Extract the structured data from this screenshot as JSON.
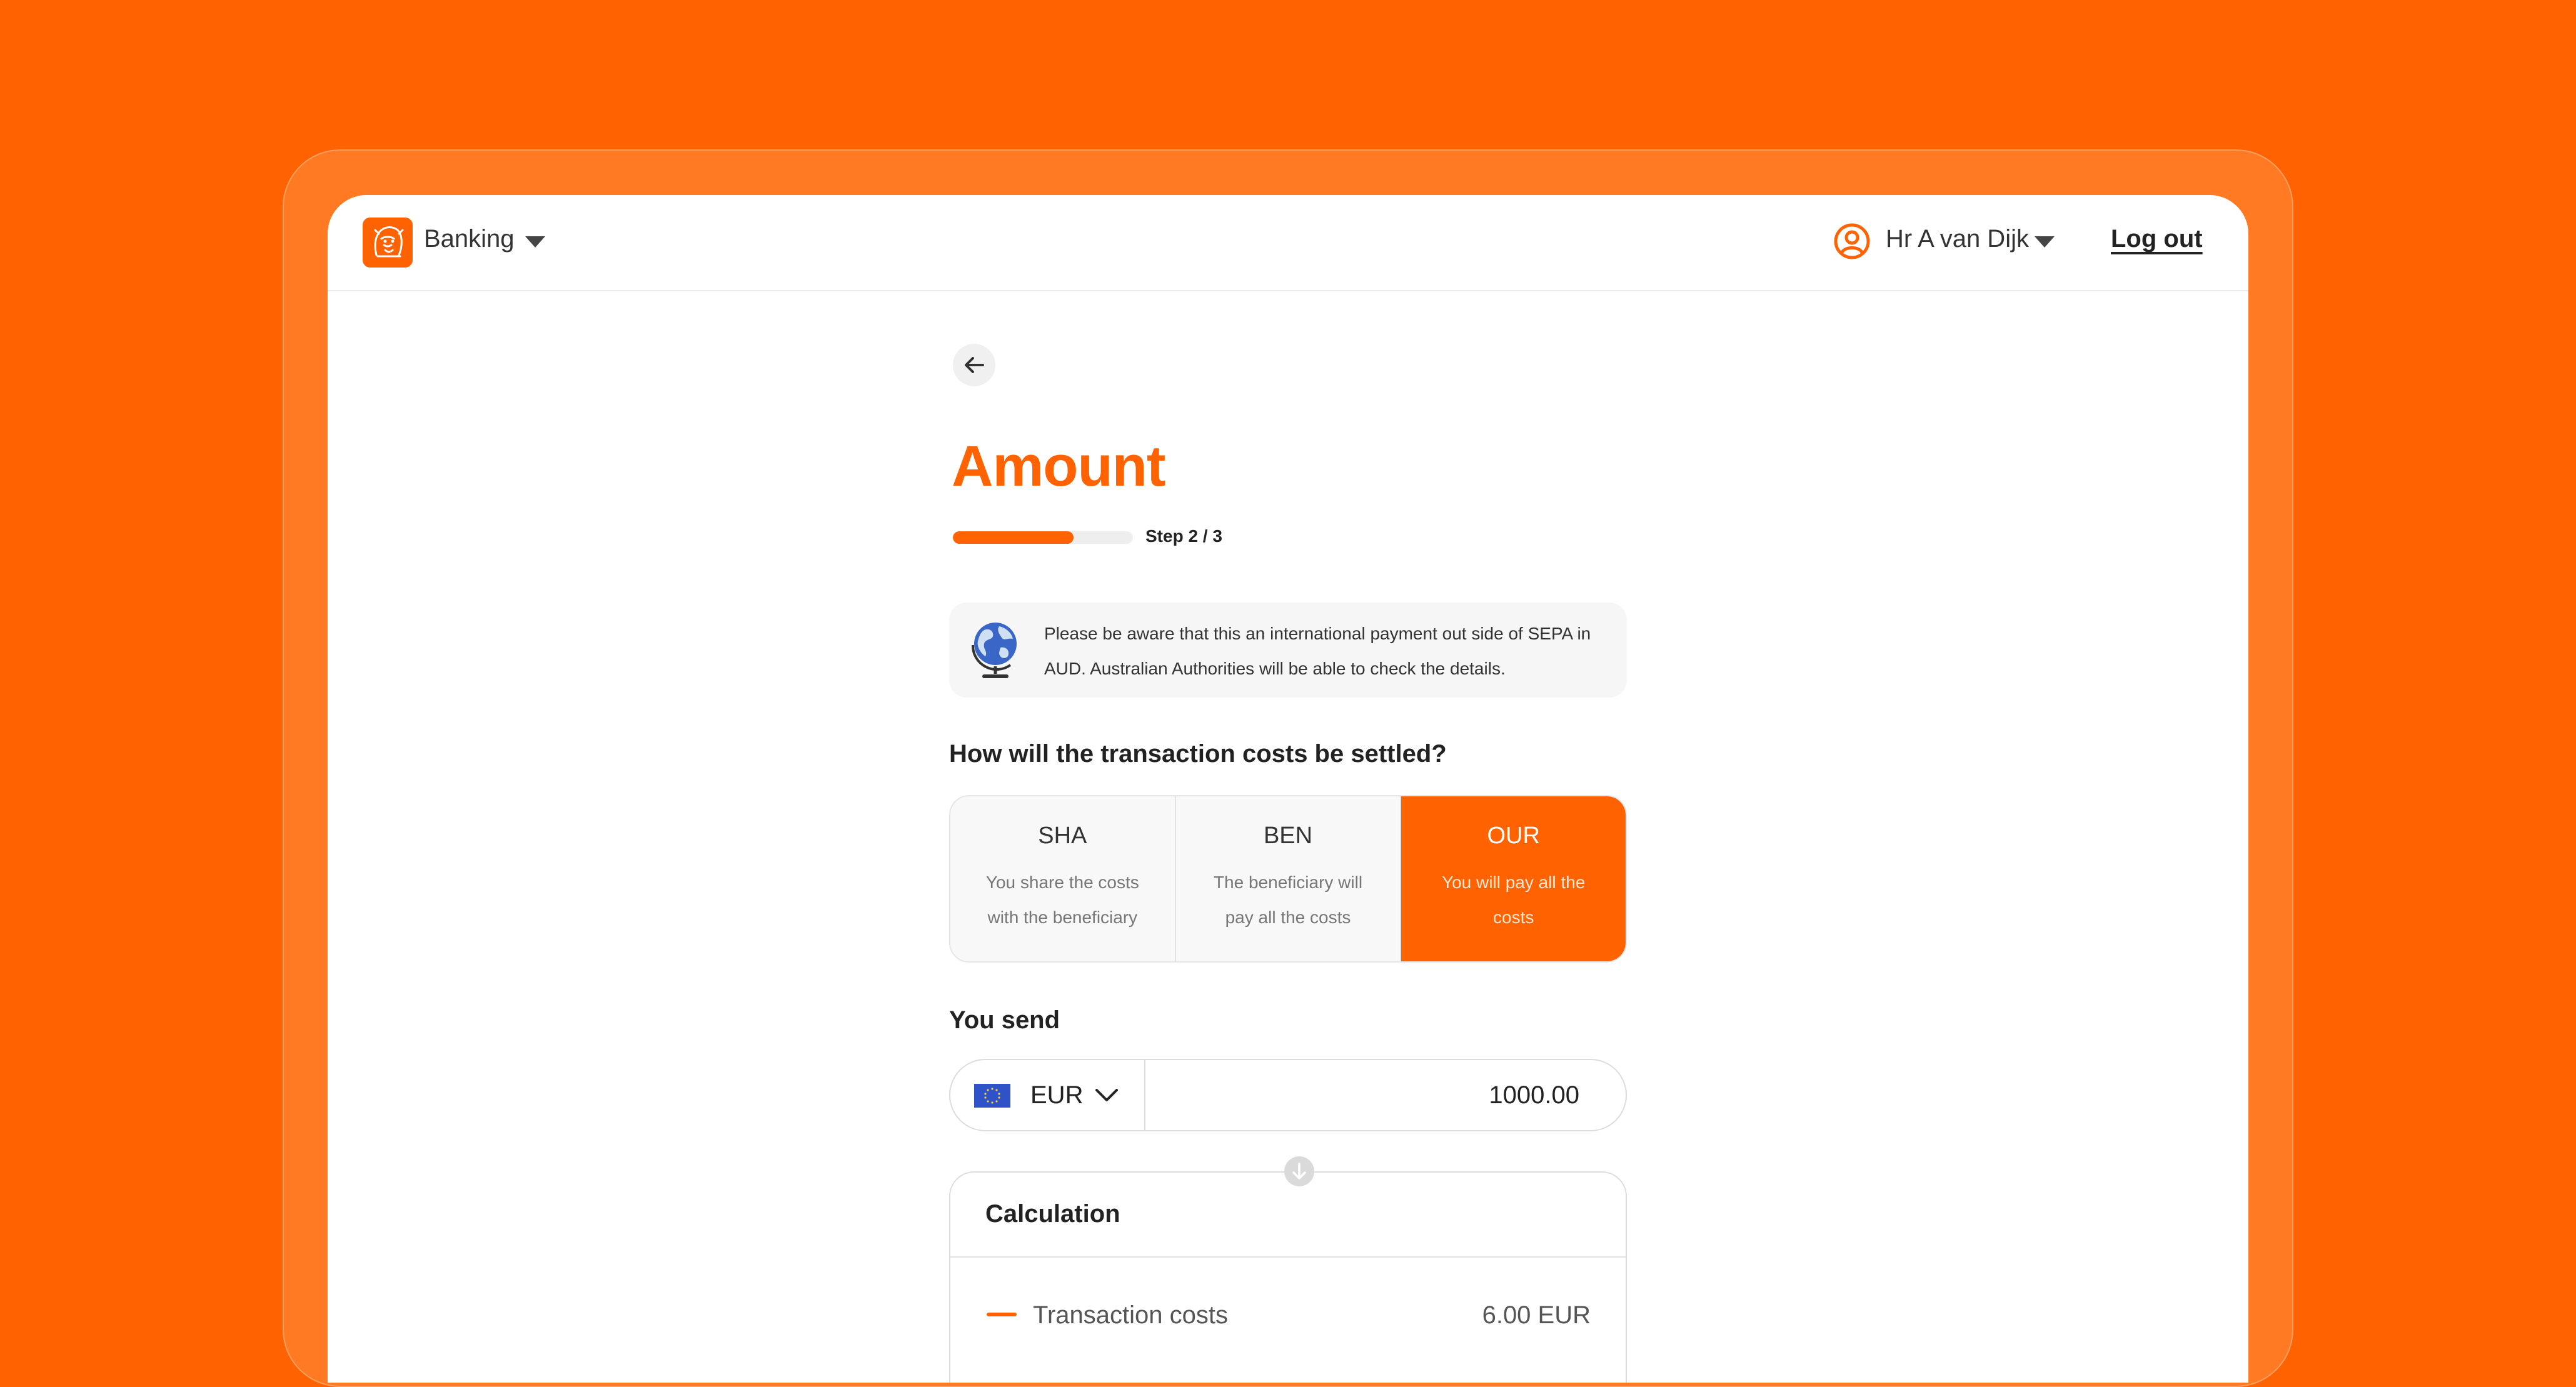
{
  "header": {
    "app_menu_label": "Banking",
    "user_name": "Hr A van Dijk",
    "logout_label": "Log out"
  },
  "page": {
    "title": "Amount",
    "step_label": "Step 2 / 3",
    "progress": 0.67
  },
  "notice": {
    "text": "Please be aware that this an international payment out side of SEPA in AUD. Australian Authorities will be able to check the details."
  },
  "costs": {
    "question": "How will the transaction costs be settled?",
    "options": [
      {
        "code": "SHA",
        "description": "You share the costs with the beneficiary",
        "selected": false
      },
      {
        "code": "BEN",
        "description": "The beneficiary will pay all the costs",
        "selected": false
      },
      {
        "code": "OUR",
        "description": "You will pay all the costs",
        "selected": true
      }
    ]
  },
  "send": {
    "label": "You send",
    "currency": "EUR",
    "amount": "1000.00"
  },
  "calculation": {
    "title": "Calculation",
    "rows": [
      {
        "label": "Transaction costs",
        "value": "6.00 EUR"
      }
    ]
  },
  "colors": {
    "brand_orange": "#FF6200"
  },
  "icons": [
    "lion-logo-icon",
    "caret-down-icon",
    "user-icon",
    "back-arrow-icon",
    "globe-icon",
    "eu-flag-icon",
    "chevron-down-icon",
    "arrow-down-icon",
    "minus-icon"
  ]
}
